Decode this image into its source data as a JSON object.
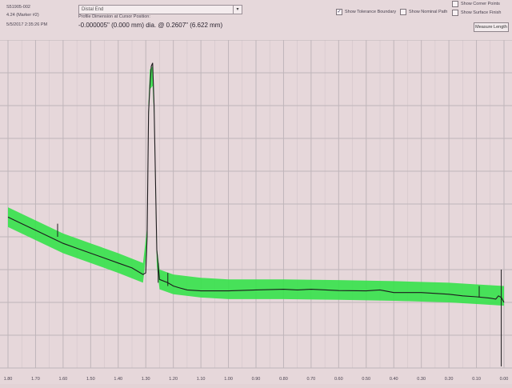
{
  "header": {
    "part_number": "S51905-002",
    "marker": "4.24 (Marker #2)",
    "datetime": "5/5/2017 2:35:26 PM",
    "section_dropdown": "Distal End",
    "profile_label": "Profile Dimension at Cursor Position:",
    "profile_value": "-0.000005\" (0.000 mm) dia.  @  0.2607\" (6.622 mm)"
  },
  "options": {
    "show_tolerance": {
      "label": "Show Tolerance Boundary",
      "checked": true
    },
    "show_nominal": {
      "label": "Show Nominal Path",
      "checked": false
    },
    "show_corner": {
      "label": "Show Corner Points",
      "checked": false
    },
    "show_surface": {
      "label": "Show Surface Finish",
      "checked": false
    },
    "check_mark": "✓",
    "dropdown_arrow": "▾"
  },
  "buttons": {
    "measure_length": "Measure Length"
  },
  "colors": {
    "tolerance": "#35e24a",
    "profile": "#1d1a1d",
    "grid": "#bfb5ba",
    "background": "#e6d7da"
  },
  "chart_data": {
    "type": "line",
    "x_ticks": [
      "1.80",
      "1.70",
      "1.60",
      "1.50",
      "1.40",
      "1.30",
      "1.20",
      "1.10",
      "1.00",
      "0.90",
      "0.80",
      "0.70",
      "0.60",
      "0.50",
      "0.40",
      "0.30",
      "0.20",
      "0.10",
      "0.00"
    ],
    "xlim": [
      1.8,
      0.0
    ],
    "ylim": [
      0,
      100
    ],
    "grid": true,
    "series": [
      {
        "x": [
          1.8,
          1.75,
          1.7,
          1.65,
          1.6,
          1.55,
          1.5,
          1.45,
          1.4,
          1.35,
          1.31,
          1.3,
          1.295,
          1.29,
          1.285,
          1.28,
          1.275,
          1.27,
          1.26,
          1.25,
          1.22,
          1.2,
          1.18,
          1.15,
          1.1,
          1.0,
          0.9,
          0.8,
          0.75,
          0.7,
          0.6,
          0.5,
          0.45,
          0.4,
          0.3,
          0.2,
          0.15,
          0.1,
          0.05,
          0.03,
          0.02,
          0.01,
          0.0
        ],
        "y": [
          46,
          44,
          42,
          40,
          38,
          36.5,
          35,
          33.5,
          32,
          30.5,
          28.5,
          29,
          40,
          78,
          86,
          92,
          93,
          80,
          36,
          27,
          26,
          25,
          24.5,
          23.8,
          23.5,
          23.5,
          23.8,
          24,
          23.8,
          24,
          23.6,
          23.5,
          23.8,
          23,
          23,
          22.5,
          22,
          21.7,
          21.3,
          21,
          22,
          21.5,
          20
        ]
      }
    ],
    "tolerance_band": {
      "x": [
        1.8,
        1.7,
        1.6,
        1.5,
        1.4,
        1.31,
        1.295,
        1.29,
        1.285,
        1.275,
        1.27,
        1.26,
        1.25,
        1.2,
        1.1,
        1.0,
        0.8,
        0.6,
        0.4,
        0.2,
        0.1,
        0.0
      ],
      "center": [
        46,
        42,
        38,
        35,
        32,
        29,
        40,
        78,
        88,
        89,
        80,
        34,
        27,
        25.5,
        24.5,
        24,
        24,
        23.8,
        23.5,
        23,
        22.5,
        22
      ],
      "half_width": 3
    }
  }
}
